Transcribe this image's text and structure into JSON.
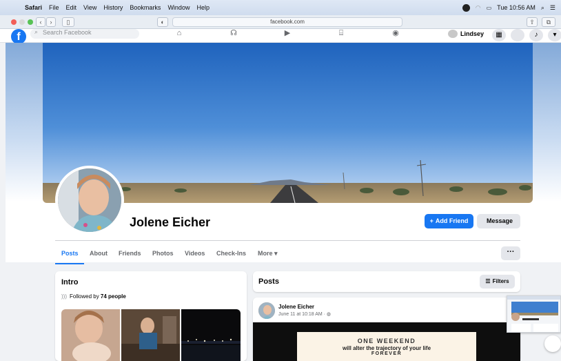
{
  "menubar": {
    "apple_icon": "apple-icon",
    "app_name": "Safari",
    "items": [
      "File",
      "Edit",
      "View",
      "History",
      "Bookmarks",
      "Window",
      "Help"
    ],
    "clock": "Tue 10:56 AM"
  },
  "browser": {
    "url": "facebook.com"
  },
  "fbnav": {
    "search_placeholder": "Search Facebook",
    "user_name": "Lindsey"
  },
  "profile": {
    "name": "Jolene Eicher",
    "add_friend_label": "Add Friend",
    "message_label": "Message",
    "tabs": [
      "Posts",
      "About",
      "Friends",
      "Photos",
      "Videos",
      "Check-Ins",
      "More ▾"
    ],
    "more_dots": "···"
  },
  "intro": {
    "title": "Intro",
    "followed_prefix": "Followed by ",
    "followed_count": "74 people"
  },
  "posts": {
    "title": "Posts",
    "filters_label": "Filters",
    "post": {
      "author": "Jolene Eicher",
      "date": "June 11 at 10:18 AM · ",
      "line1": "ONE WEEKEND",
      "line2": "will alter the trajectory of your life",
      "line3": "FOREVER"
    }
  },
  "colors": {
    "facebook_blue": "#1877f2",
    "page_bg": "#f0f2f5"
  }
}
